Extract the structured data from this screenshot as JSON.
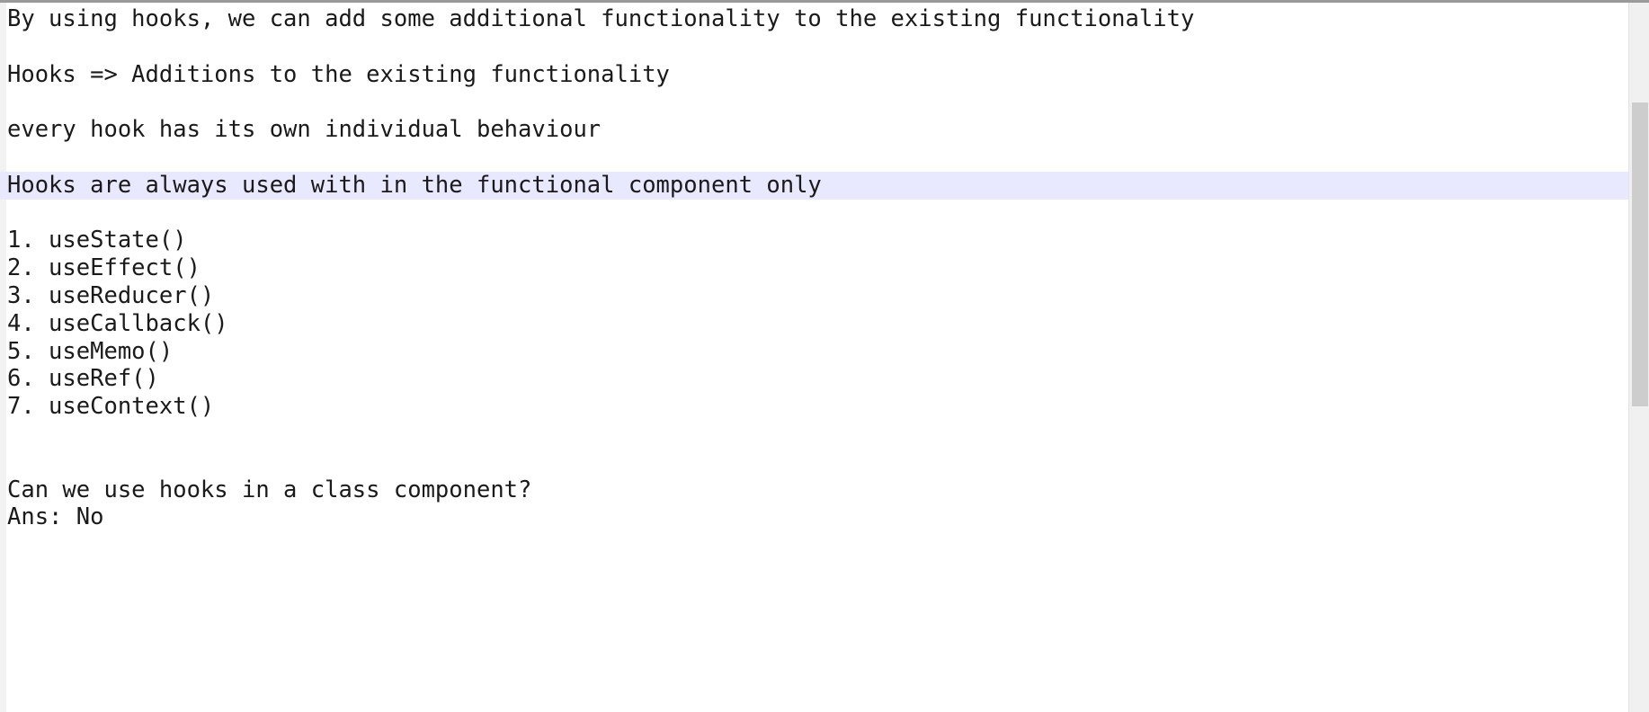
{
  "editor": {
    "lines": [
      "By using hooks, we can add some additional functionality to the existing functionality",
      "",
      "Hooks => Additions to the existing functionality",
      "",
      "every hook has its own individual behaviour",
      "",
      "Hooks are always used with in the functional component only",
      "",
      "1. useState()",
      "2. useEffect()",
      "3. useReducer()",
      "4. useCallback()",
      "5. useMemo()",
      "6. useRef()",
      "7. useContext()",
      "",
      "",
      "Can we use hooks in a class component?",
      "Ans: No"
    ],
    "current_line_index": 6
  },
  "colors": {
    "current_line_highlight": "#e8e8ff",
    "text": "#1a1a1a",
    "scrollbar_track": "#f0f0f0",
    "scrollbar_thumb": "#cdcdcd"
  }
}
